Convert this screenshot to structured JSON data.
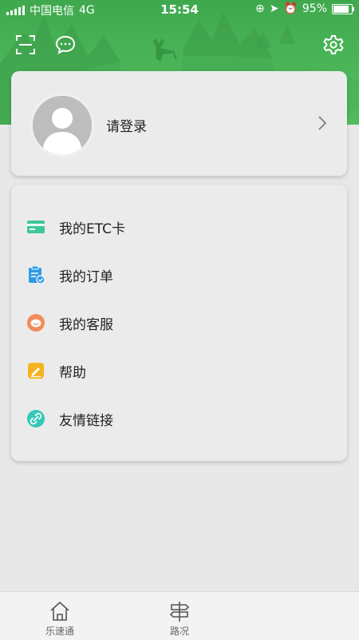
{
  "status_bar": {
    "carrier": "中国电信",
    "network": "4G",
    "time": "15:54",
    "battery": "95%",
    "battery_level": 0.95
  },
  "header": {
    "scan_icon": "scan-icon",
    "message_icon": "message-icon",
    "settings_icon": "settings-icon",
    "accent": "#4cb85a"
  },
  "profile": {
    "login_label": "请登录"
  },
  "menu": {
    "items": [
      {
        "label": "我的ETC卡",
        "icon": "etc-card-icon",
        "color": "#3ec896"
      },
      {
        "label": "我的订单",
        "icon": "order-icon",
        "color": "#2f9be6"
      },
      {
        "label": "我的客服",
        "icon": "service-icon",
        "color": "#f28a5a"
      },
      {
        "label": "帮助",
        "icon": "help-icon",
        "color": "#f5b321"
      },
      {
        "label": "友情链接",
        "icon": "link-icon",
        "color": "#36c8b8"
      }
    ]
  },
  "tabbar": {
    "tabs": [
      {
        "label": "乐速通",
        "icon": "home-icon"
      },
      {
        "label": "路况",
        "icon": "signpost-icon"
      }
    ]
  }
}
